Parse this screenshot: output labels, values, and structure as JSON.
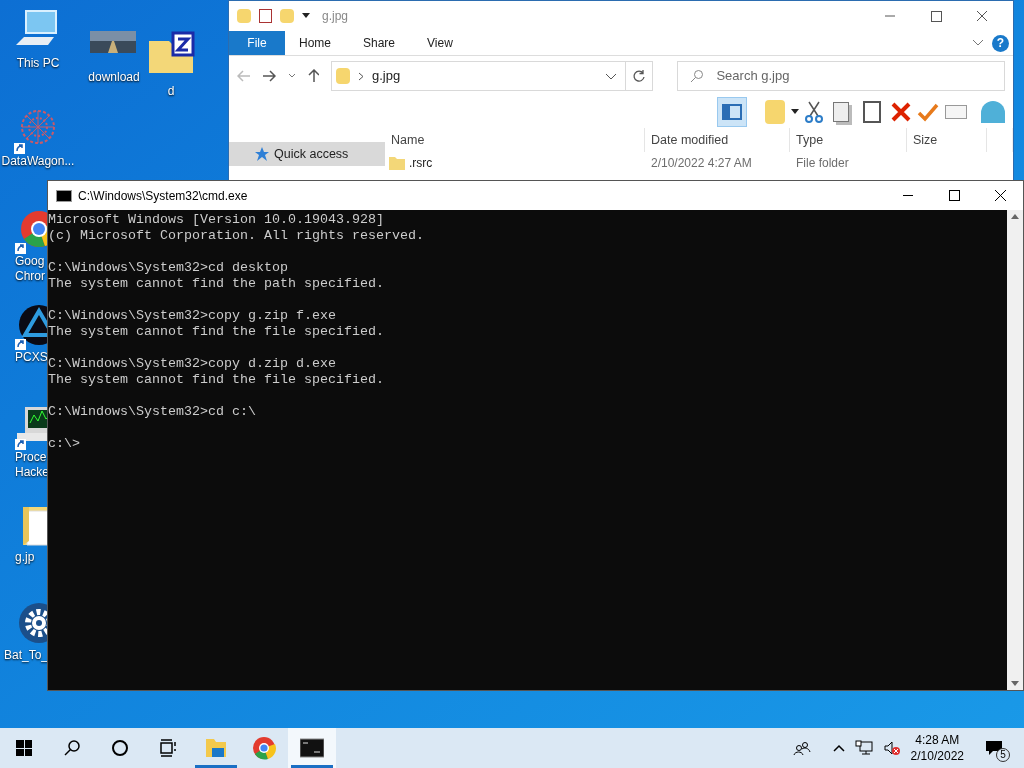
{
  "desktop_icons": [
    {
      "kind": "pc",
      "lines": [
        "This PC"
      ],
      "shortcut": false
    },
    {
      "kind": "photo",
      "lines": [
        "download"
      ],
      "shortcut": false
    },
    {
      "kind": "zip",
      "lines": [
        "d"
      ],
      "shortcut": false
    },
    {
      "kind": "web",
      "lines": [
        "DataWagon..."
      ],
      "shortcut": true
    },
    {
      "kind": "chrome",
      "lines": [
        "Goog",
        "Chror"
      ],
      "shortcut": true
    },
    {
      "kind": "triangle",
      "lines": [
        "PCXS"
      ],
      "shortcut": true
    },
    {
      "kind": "monitor",
      "lines": [
        "Proce",
        "Hacke"
      ],
      "shortcut": true
    },
    {
      "kind": "folder",
      "lines": [
        "g.jp"
      ],
      "shortcut": false
    },
    {
      "kind": "gear",
      "lines": [
        "Bat_To_"
      ],
      "shortcut": false
    }
  ],
  "explorer": {
    "title": "g.jpg",
    "ribbon_tabs": [
      {
        "label": "File",
        "selected": true
      },
      {
        "label": "Home",
        "selected": false
      },
      {
        "label": "Share",
        "selected": false
      },
      {
        "label": "View",
        "selected": false
      }
    ],
    "help": "?",
    "address": "g.jpg",
    "search": {
      "placeholder": "Search g.jpg"
    },
    "columns": [
      "Name",
      "Date modified",
      "Type",
      "Size"
    ],
    "rows": [
      {
        "name": ".rsrc",
        "date": "2/10/2022 4:27 AM",
        "type": "File folder"
      }
    ],
    "nav_items": [
      {
        "label": "Quick access",
        "selected": true
      }
    ]
  },
  "cmd": {
    "title": "C:\\Windows\\System32\\cmd.exe",
    "blocks": [
      [
        "Microsoft Windows [Version 10.0.19043.928]",
        "(c) Microsoft Corporation. All rights reserved."
      ],
      [
        "C:\\Windows\\System32>cd desktop",
        "The system cannot find the path specified."
      ],
      [
        "C:\\Windows\\System32>copy g.zip f.exe",
        "The system cannot find the file specified."
      ],
      [
        "C:\\Windows\\System32>copy d.zip d.exe",
        "The system cannot find the file specified."
      ],
      [
        "C:\\Windows\\System32>cd c:\\"
      ],
      [
        "c:\\>"
      ]
    ]
  },
  "taskbar": {
    "apps": [
      {
        "kind": "explorer",
        "running": true,
        "active": false
      },
      {
        "kind": "chrome",
        "running": false,
        "active": false
      },
      {
        "kind": "cmd",
        "running": true,
        "active": true
      }
    ],
    "time": "4:28 AM",
    "date": "2/10/2022",
    "notifications": "5"
  }
}
